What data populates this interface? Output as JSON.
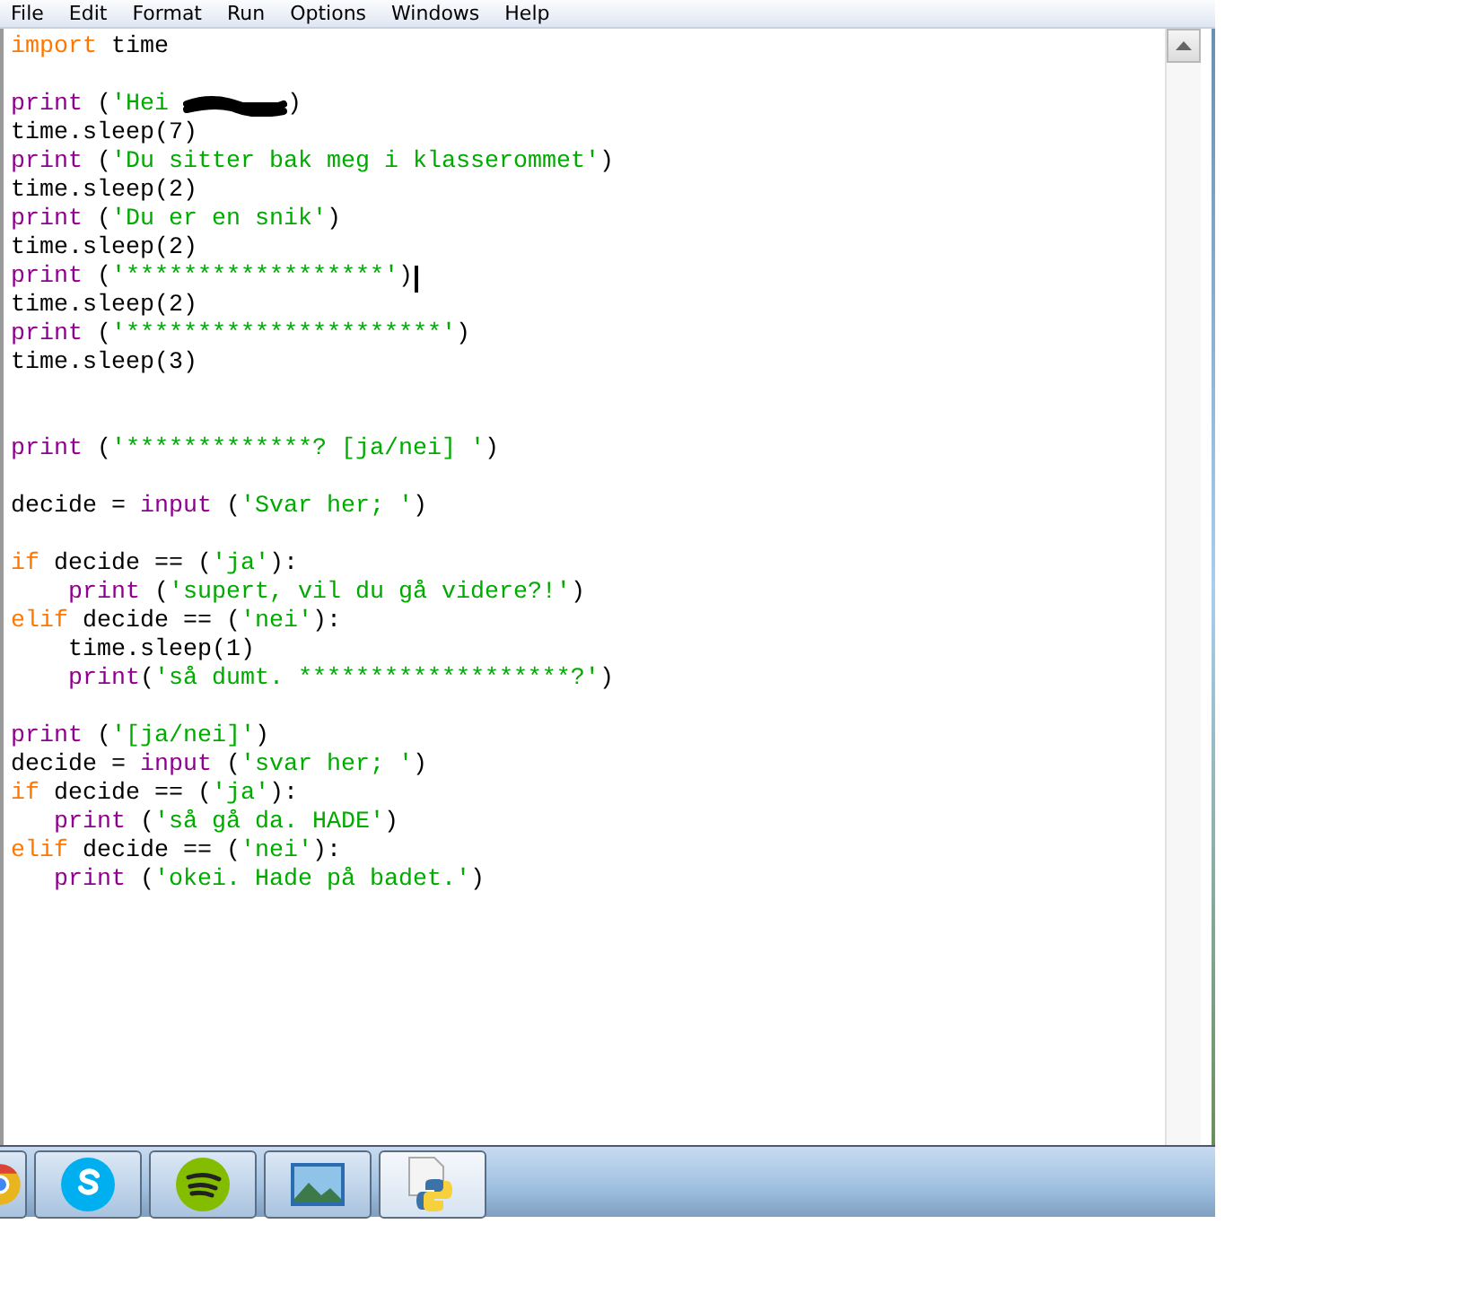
{
  "menu": [
    "File",
    "Edit",
    "Format",
    "Run",
    "Options",
    "Windows",
    "Help"
  ],
  "lines": [
    {
      "tokens": [
        {
          "kind": "keyword",
          "text": "import"
        },
        {
          "kind": "plain",
          "text": " time"
        }
      ]
    },
    {
      "blank_before": true,
      "tokens": [
        {
          "kind": "builtin",
          "text": "print"
        },
        {
          "kind": "plain",
          "text": " ("
        },
        {
          "kind": "string",
          "text": "'Hei "
        },
        {
          "kind": "redaction"
        },
        {
          "kind": "plain",
          "text": ")"
        }
      ]
    },
    {
      "tokens": [
        {
          "kind": "plain",
          "text": "time.sleep(7)"
        }
      ]
    },
    {
      "tokens": [
        {
          "kind": "builtin",
          "text": "print"
        },
        {
          "kind": "plain",
          "text": " ("
        },
        {
          "kind": "string",
          "text": "'Du sitter bak meg i klasserommet'"
        },
        {
          "kind": "plain",
          "text": ")"
        }
      ]
    },
    {
      "tokens": [
        {
          "kind": "plain",
          "text": "time.sleep(2)"
        }
      ]
    },
    {
      "tokens": [
        {
          "kind": "builtin",
          "text": "print"
        },
        {
          "kind": "plain",
          "text": " ("
        },
        {
          "kind": "string",
          "text": "'Du er en snik'"
        },
        {
          "kind": "plain",
          "text": ")"
        }
      ]
    },
    {
      "tokens": [
        {
          "kind": "plain",
          "text": "time.sleep(2)"
        }
      ]
    },
    {
      "cursor": true,
      "tokens": [
        {
          "kind": "builtin",
          "text": "print"
        },
        {
          "kind": "plain",
          "text": " ("
        },
        {
          "kind": "string",
          "text": "'******************'"
        },
        {
          "kind": "plain",
          "text": ")"
        }
      ]
    },
    {
      "tokens": [
        {
          "kind": "plain",
          "text": "time.sleep(2)"
        }
      ]
    },
    {
      "tokens": [
        {
          "kind": "builtin",
          "text": "print"
        },
        {
          "kind": "plain",
          "text": " ("
        },
        {
          "kind": "string",
          "text": "'**********************'"
        },
        {
          "kind": "plain",
          "text": ")"
        }
      ]
    },
    {
      "tokens": [
        {
          "kind": "plain",
          "text": "time.sleep(3)"
        }
      ]
    },
    {
      "blank_before": true,
      "double_blank_before": true,
      "tokens": [
        {
          "kind": "builtin",
          "text": "print"
        },
        {
          "kind": "plain",
          "text": " ("
        },
        {
          "kind": "string",
          "text": "'*************? [ja/nei] '"
        },
        {
          "kind": "plain",
          "text": ")"
        }
      ]
    },
    {
      "blank_before": true,
      "tokens": [
        {
          "kind": "plain",
          "text": "decide = "
        },
        {
          "kind": "builtin",
          "text": "input"
        },
        {
          "kind": "plain",
          "text": " ("
        },
        {
          "kind": "string",
          "text": "'Svar her; '"
        },
        {
          "kind": "plain",
          "text": ")"
        }
      ]
    },
    {
      "blank_before": true,
      "tokens": [
        {
          "kind": "keyword",
          "text": "if"
        },
        {
          "kind": "plain",
          "text": " decide == ("
        },
        {
          "kind": "string",
          "text": "'ja'"
        },
        {
          "kind": "plain",
          "text": "):"
        }
      ]
    },
    {
      "tokens": [
        {
          "kind": "builtin",
          "text": "    print"
        },
        {
          "kind": "plain",
          "text": " ("
        },
        {
          "kind": "string",
          "text": "'supert, vil du gå videre?!'"
        },
        {
          "kind": "plain",
          "text": ")"
        }
      ]
    },
    {
      "tokens": [
        {
          "kind": "keyword",
          "text": "elif"
        },
        {
          "kind": "plain",
          "text": " decide == ("
        },
        {
          "kind": "string",
          "text": "'nei'"
        },
        {
          "kind": "plain",
          "text": "):"
        }
      ]
    },
    {
      "tokens": [
        {
          "kind": "plain",
          "text": "    time.sleep(1)"
        }
      ]
    },
    {
      "tokens": [
        {
          "kind": "builtin",
          "text": "    print"
        },
        {
          "kind": "plain",
          "text": "("
        },
        {
          "kind": "string",
          "text": "'så dumt. *******************?'"
        },
        {
          "kind": "plain",
          "text": ")"
        }
      ]
    },
    {
      "blank_before": true,
      "tokens": [
        {
          "kind": "builtin",
          "text": "print"
        },
        {
          "kind": "plain",
          "text": " ("
        },
        {
          "kind": "string",
          "text": "'[ja/nei]'"
        },
        {
          "kind": "plain",
          "text": ")"
        }
      ]
    },
    {
      "tokens": [
        {
          "kind": "plain",
          "text": "decide = "
        },
        {
          "kind": "builtin",
          "text": "input"
        },
        {
          "kind": "plain",
          "text": " ("
        },
        {
          "kind": "string",
          "text": "'svar her; '"
        },
        {
          "kind": "plain",
          "text": ")"
        }
      ]
    },
    {
      "tokens": [
        {
          "kind": "keyword",
          "text": "if"
        },
        {
          "kind": "plain",
          "text": " decide == ("
        },
        {
          "kind": "string",
          "text": "'ja'"
        },
        {
          "kind": "plain",
          "text": "):"
        }
      ]
    },
    {
      "tokens": [
        {
          "kind": "builtin",
          "text": "   print"
        },
        {
          "kind": "plain",
          "text": " ("
        },
        {
          "kind": "string",
          "text": "'så gå da. HADE'"
        },
        {
          "kind": "plain",
          "text": ")"
        }
      ]
    },
    {
      "tokens": [
        {
          "kind": "keyword",
          "text": "elif"
        },
        {
          "kind": "plain",
          "text": " decide == ("
        },
        {
          "kind": "string",
          "text": "'nei'"
        },
        {
          "kind": "plain",
          "text": "):"
        }
      ]
    },
    {
      "tokens": [
        {
          "kind": "builtin",
          "text": "   print"
        },
        {
          "kind": "plain",
          "text": " ("
        },
        {
          "kind": "string",
          "text": "'okei. Hade på badet.'"
        },
        {
          "kind": "plain",
          "text": ")"
        }
      ]
    }
  ],
  "taskbar": [
    {
      "kind": "chrome",
      "selected": false
    },
    {
      "kind": "skype",
      "selected": false
    },
    {
      "kind": "spotify",
      "selected": false
    },
    {
      "kind": "photos",
      "selected": false
    },
    {
      "kind": "python",
      "selected": true
    }
  ]
}
